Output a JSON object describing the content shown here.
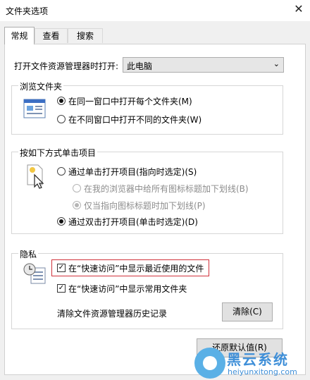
{
  "window": {
    "title": "文件夹选项",
    "close_glyph": "✕"
  },
  "tabs": [
    {
      "label": "常规"
    },
    {
      "label": "查看"
    },
    {
      "label": "搜索"
    }
  ],
  "open_explorer": {
    "label": "打开文件资源管理器时打开:",
    "value": "此电脑"
  },
  "browse": {
    "legend": "浏览文件夹",
    "options": [
      {
        "label": "在同一窗口中打开每个文件夹(M)",
        "selected": true
      },
      {
        "label": "在不同窗口中打开不同的文件夹(W)",
        "selected": false
      }
    ]
  },
  "click": {
    "legend": "按如下方式单击项目",
    "single": {
      "label": "通过单击打开项目(指向时选定)(S)",
      "selected": false
    },
    "sub1": {
      "label": "在我的浏览器中给所有图标标题加下划线(B)",
      "selected": false,
      "disabled": true
    },
    "sub2": {
      "label": "仅当指向图标标题时加下划线(P)",
      "selected": true,
      "disabled": true
    },
    "double": {
      "label": "通过双击打开项目(单击时选定)(D)",
      "selected": true
    }
  },
  "privacy": {
    "legend": "隐私",
    "recent_files": {
      "label": "在“快速访问”中显示最近使用的文件",
      "checked": true
    },
    "frequent_folders": {
      "label": "在“快速访问”中显示常用文件夹",
      "checked": true
    },
    "clear_label": "清除文件资源管理器历史记录",
    "clear_button": "清除(C)"
  },
  "restore_button": "还原默认值(R)",
  "watermark": {
    "name": "黑云系统",
    "url": "heiyunxitong.com"
  },
  "colors": {
    "highlight_border": "#d0313a",
    "watermark": "#3f8fd8"
  }
}
